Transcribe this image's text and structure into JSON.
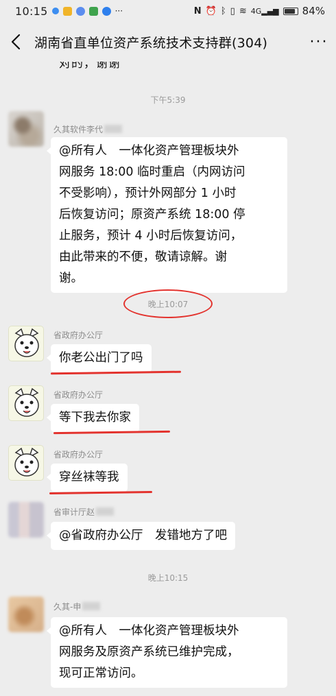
{
  "status_bar": {
    "time": "10:15",
    "signal": "4G",
    "battery": "84%",
    "battery_level": 0.84
  },
  "header": {
    "back_icon": "chevron-left-icon",
    "title": "湖南省直单位资产系统技术支持群(304)",
    "more_icon": "more-horizontal-icon",
    "more_label": "···"
  },
  "chat": {
    "partial_top_text": "对的，谢谢",
    "timestamps": [
      "下午5:39",
      "晚上10:07",
      "晚上10:15"
    ],
    "messages": [
      {
        "sender": "久其软件李代",
        "avatar": "blurred-avatar",
        "lines": [
          "@所有人　一体化资产管理板块外",
          "网服务 18:00 临时重启（内网访问",
          "不受影响），预计外网部分 1 小时",
          "后恢复访问；原资产系统 18:00 停",
          "止服务，预计 4 小时后恢复访问，",
          "由此带来的不便，敬请谅解。谢",
          "谢。"
        ]
      },
      {
        "sender": "省政府办公厅",
        "avatar": "dog-avatar",
        "lines": [
          "你老公出门了吗"
        ]
      },
      {
        "sender": "省政府办公厅",
        "avatar": "dog-avatar",
        "lines": [
          "等下我去你家"
        ]
      },
      {
        "sender": "省政府办公厅",
        "avatar": "dog-avatar",
        "lines": [
          "穿丝袜等我"
        ]
      },
      {
        "sender": "省审计厅赵",
        "avatar": "blurred-avatar",
        "lines": [
          "@省政府办公厅　发错地方了吧"
        ]
      },
      {
        "sender": "久其-申",
        "avatar": "blurred-avatar",
        "lines": [
          "@所有人　一体化资产管理板块外",
          "网服务及原资产系统已维护完成，",
          "现可正常访问。"
        ]
      }
    ]
  },
  "colors": {
    "background": "#ededed",
    "bubble": "#ffffff",
    "annotation_red": "#e3332e",
    "timestamp": "#9a9a9a",
    "sender": "#8c8c8c"
  }
}
